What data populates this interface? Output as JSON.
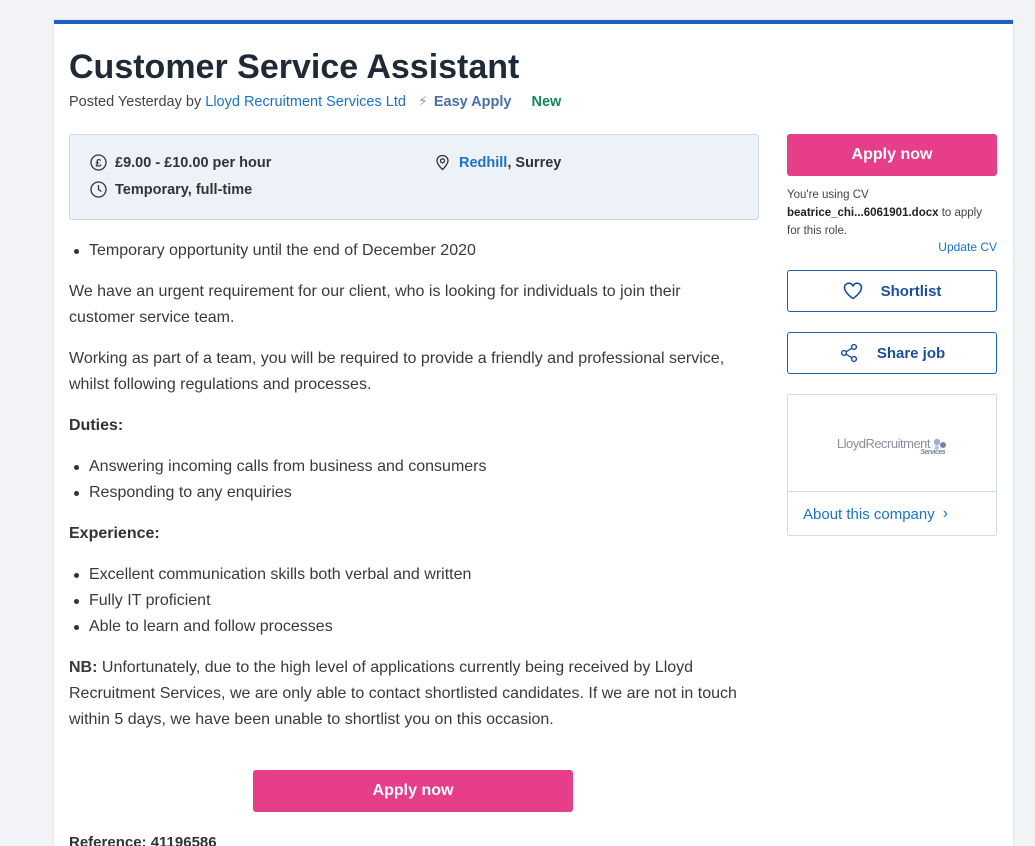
{
  "job": {
    "title": "Customer Service Assistant",
    "posted": "Posted Yesterday by",
    "company": "Lloyd Recruitment Services Ltd",
    "easy_apply": "Easy Apply",
    "new_badge": "New"
  },
  "summary": {
    "salary": "£9.00 - £10.00 per hour",
    "type": "Temporary, full-time",
    "location_town": "Redhill",
    "location_county": ", Surrey"
  },
  "description": {
    "intro_bullet": "Temporary opportunity until the end of December 2020",
    "para1": "We have an urgent requirement for our client, who is looking for individuals to join their customer service team.",
    "para2": "Working as part of a team, you will be required to provide a friendly and professional service, whilst following regulations and processes.",
    "duties_heading": "Duties:",
    "duties": [
      "Answering incoming calls from business and consumers",
      "Responding to any enquiries"
    ],
    "experience_heading": "Experience:",
    "experience": [
      "Excellent communication skills both verbal and written",
      "Fully IT proficient",
      "Able to learn and follow processes"
    ],
    "nb_label": "NB:",
    "nb_text": " Unfortunately, due to the high level of applications currently being received by Lloyd Recruitment Services, we are only able to contact shortlisted candidates. If we are not in touch within 5 days, we have been unable to shortlist you on this occasion.",
    "reference": "Reference: 41196586"
  },
  "sidebar": {
    "apply_label": "Apply now",
    "cv_prefix": "You're using CV",
    "cv_file": "beatrice_chi...6061901.docx",
    "cv_suffix": " to apply for this role.",
    "update_cv": "Update CV",
    "shortlist": "Shortlist",
    "share": "Share job",
    "logo_text": "LloydRecruitment",
    "logo_sub": "Services",
    "about": "About this company"
  },
  "bottom": {
    "apply_label": "Apply now"
  },
  "colors": {
    "accent": "#e63e88",
    "link": "#1a73c9",
    "header_border": "#1f5fbf",
    "new": "#148a5a"
  },
  "icons": [
    "pound-icon",
    "clock-icon",
    "location-pin-icon",
    "lightning-icon",
    "heart-icon",
    "share-icon",
    "chevron-right-icon"
  ]
}
